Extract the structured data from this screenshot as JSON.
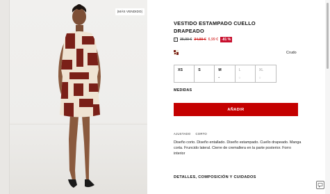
{
  "product_image": {
    "badge": "|MÁS VENDIDO|"
  },
  "product": {
    "title": "VESTIDO ESTAMPADO CUELLO DRAPEADO",
    "price_original": "35,99 €",
    "price_previous": "34,99 €",
    "price_current": "6,99 €",
    "discount": "-81 %"
  },
  "color": {
    "name": "Crudo",
    "swatch_colors": [
      "#7a2018",
      "#efe3d2"
    ]
  },
  "sizes": [
    {
      "label": "XS",
      "sub": ""
    },
    {
      "label": "S",
      "sub": ""
    },
    {
      "label": "M",
      "sub": "•"
    },
    {
      "label": "L",
      "sub": "◌"
    },
    {
      "label": "XL",
      "sub": "◌"
    }
  ],
  "medidas_label": "MEDIDAS",
  "add_button": "AÑADIR",
  "tabs": [
    "A&#8203;JUSTADO",
    "CORTO"
  ],
  "description": "Diseño corto. Diseño entallado. Diseño estampado. Cuello drapeado. Manga corta. Fruncido lateral. Cierre de cremallera en la parte posterior. Forro interior",
  "details_heading": "DETALLES, COMPOSICIÓN Y CUIDADOS",
  "icons": {
    "info": "info-icon",
    "chat": "chat-icon"
  }
}
